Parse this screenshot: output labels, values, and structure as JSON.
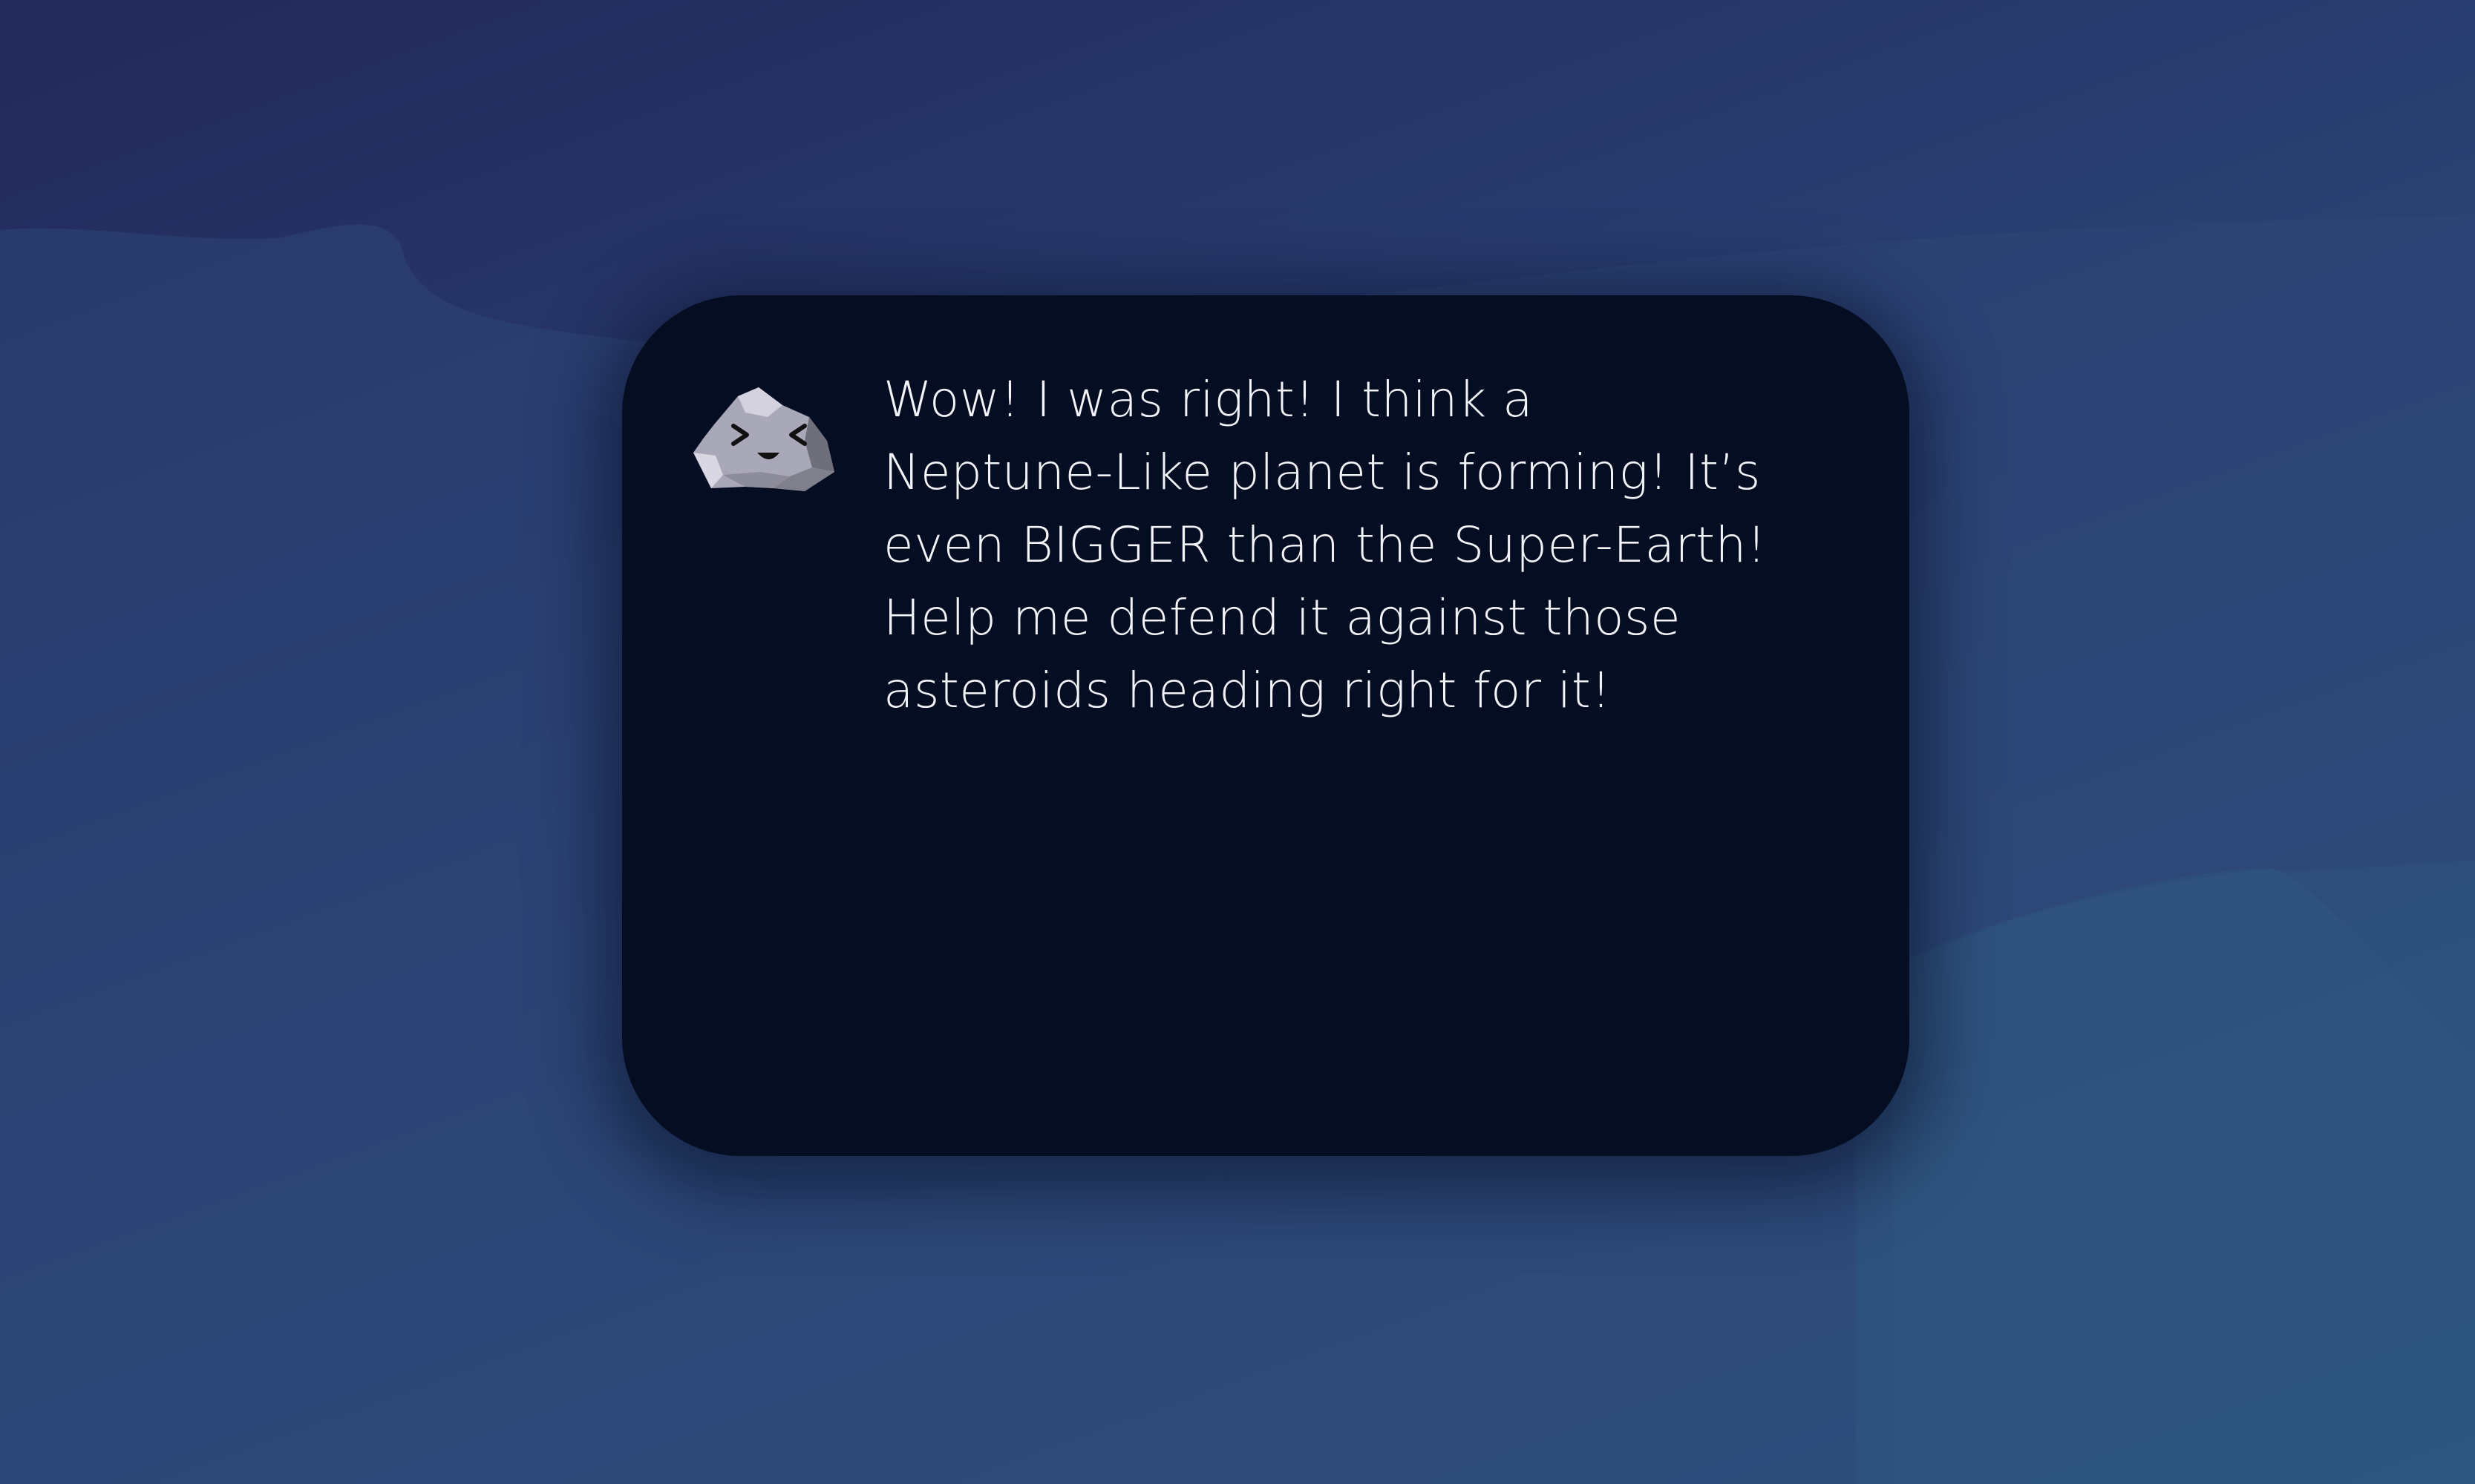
{
  "colors": {
    "background_top": "#23295a",
    "background_bottom": "#2f5780",
    "dialog_background": "#040d22",
    "dialog_text": "#f2f4f8",
    "rock_light": "#c7c6d4",
    "rock_mid": "#a9a8b8",
    "rock_dark": "#6f6f7c"
  },
  "dialog": {
    "speaker_icon": "happy-rock-icon",
    "message": "Wow! I was right! I think a\nNeptune-Like planet is forming! It’s\neven BIGGER than the Super-Earth!\nHelp me defend it against those\nasteroids heading right for it!"
  }
}
